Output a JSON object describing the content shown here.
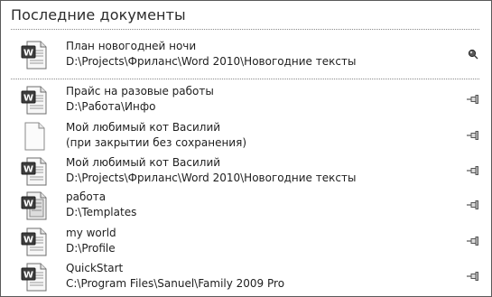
{
  "panel": {
    "title": "Последние документы"
  },
  "documents": [
    {
      "name": "План новогодней ночи",
      "path": "D:\\Projects\\Фриланс\\Word 2010\\Новогодние тексты",
      "icon": "word-document-icon",
      "pinned": true
    },
    {
      "name": "Прайс на разовые работы",
      "path": "D:\\Работа\\Инфо",
      "icon": "word-document-icon",
      "pinned": false
    },
    {
      "name": "Мой любимый кот Василий",
      "path": "(при закрытии без сохранения)",
      "icon": "blank-document-icon",
      "pinned": false
    },
    {
      "name": "Мой любимый кот Василий",
      "path": "D:\\Projects\\Фриланс\\Word 2010\\Новогодние тексты",
      "icon": "word-document-icon",
      "pinned": false
    },
    {
      "name": "работа",
      "path": "D:\\Templates",
      "icon": "word-template-icon",
      "pinned": false
    },
    {
      "name": "my world",
      "path": "D:\\Profile",
      "icon": "word-document-icon",
      "pinned": false
    },
    {
      "name": "QuickStart",
      "path": "C:\\Program Files\\Sanuel\\Family 2009 Pro",
      "icon": "word-document-icon",
      "pinned": false
    }
  ]
}
